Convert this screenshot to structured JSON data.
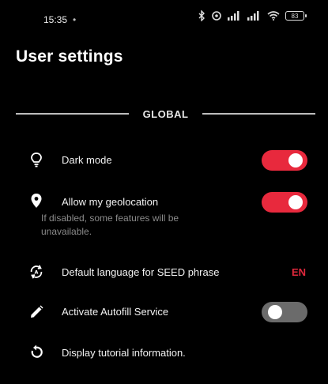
{
  "status_bar": {
    "time": "15:35",
    "dot": "•",
    "battery_level": "83",
    "icons": [
      "bluetooth-icon",
      "alarm-icon",
      "signal-icon",
      "signal-icon",
      "wifi-icon",
      "battery-icon"
    ]
  },
  "title": "User settings",
  "section": {
    "label": "GLOBAL"
  },
  "settings": {
    "dark_mode": {
      "label": "Dark mode",
      "icon": "lightbulb-icon",
      "enabled": true
    },
    "geolocation": {
      "label": "Allow my geolocation",
      "subtitle": "If disabled, some features will be unavailable.",
      "icon": "location-pin-icon",
      "enabled": true
    },
    "language": {
      "label": "Default language for SEED phrase",
      "icon": "language-swap-icon",
      "value": "EN"
    },
    "autofill": {
      "label": "Activate Autofill Service",
      "icon": "pencil-icon",
      "enabled": false
    },
    "tutorial": {
      "label": "Display tutorial information.",
      "icon": "refresh-icon"
    }
  },
  "colors": {
    "accent": "#e8293d",
    "toggle_off": "#6b6b6b",
    "background": "#000000"
  }
}
